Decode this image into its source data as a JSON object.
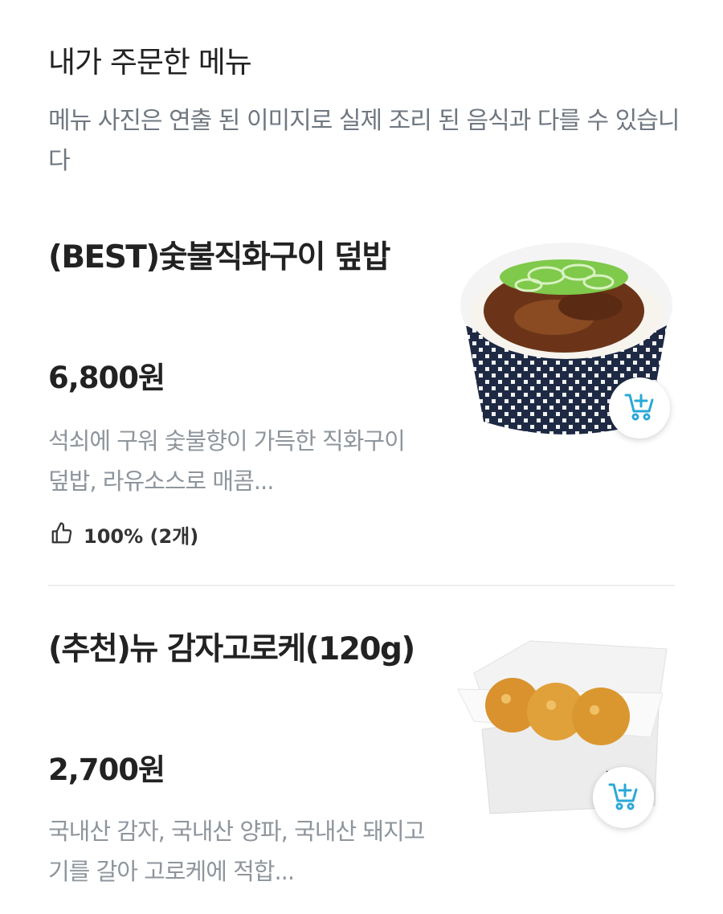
{
  "section": {
    "title": "내가 주문한 메뉴",
    "description": "메뉴 사진은 연출 된 이미지로 실제 조리 된 음식과 다를 수 있습니다"
  },
  "menu": [
    {
      "name": "(BEST)숯불직화구이 덮밥",
      "price": "6,800원",
      "description": "석쇠에 구워 숯불향이 가득한 직화구이 덮밥, 라유소스로 매콤...",
      "rating": "100% (2개)",
      "image_icon": "bowl-image",
      "cart_icon": "cart-plus-icon"
    },
    {
      "name": "(추천)뉴 감자고로케(120g)",
      "price": "2,700원",
      "description": "국내산 감자, 국내산 양파, 국내산 돼지고기를 갈아 고로케에 적합...",
      "image_icon": "croquette-image",
      "cart_icon": "cart-plus-icon"
    }
  ],
  "colors": {
    "accent": "#2aa8d8",
    "text_primary": "#222222",
    "text_secondary": "#8e959c",
    "divider": "#eceef0"
  }
}
